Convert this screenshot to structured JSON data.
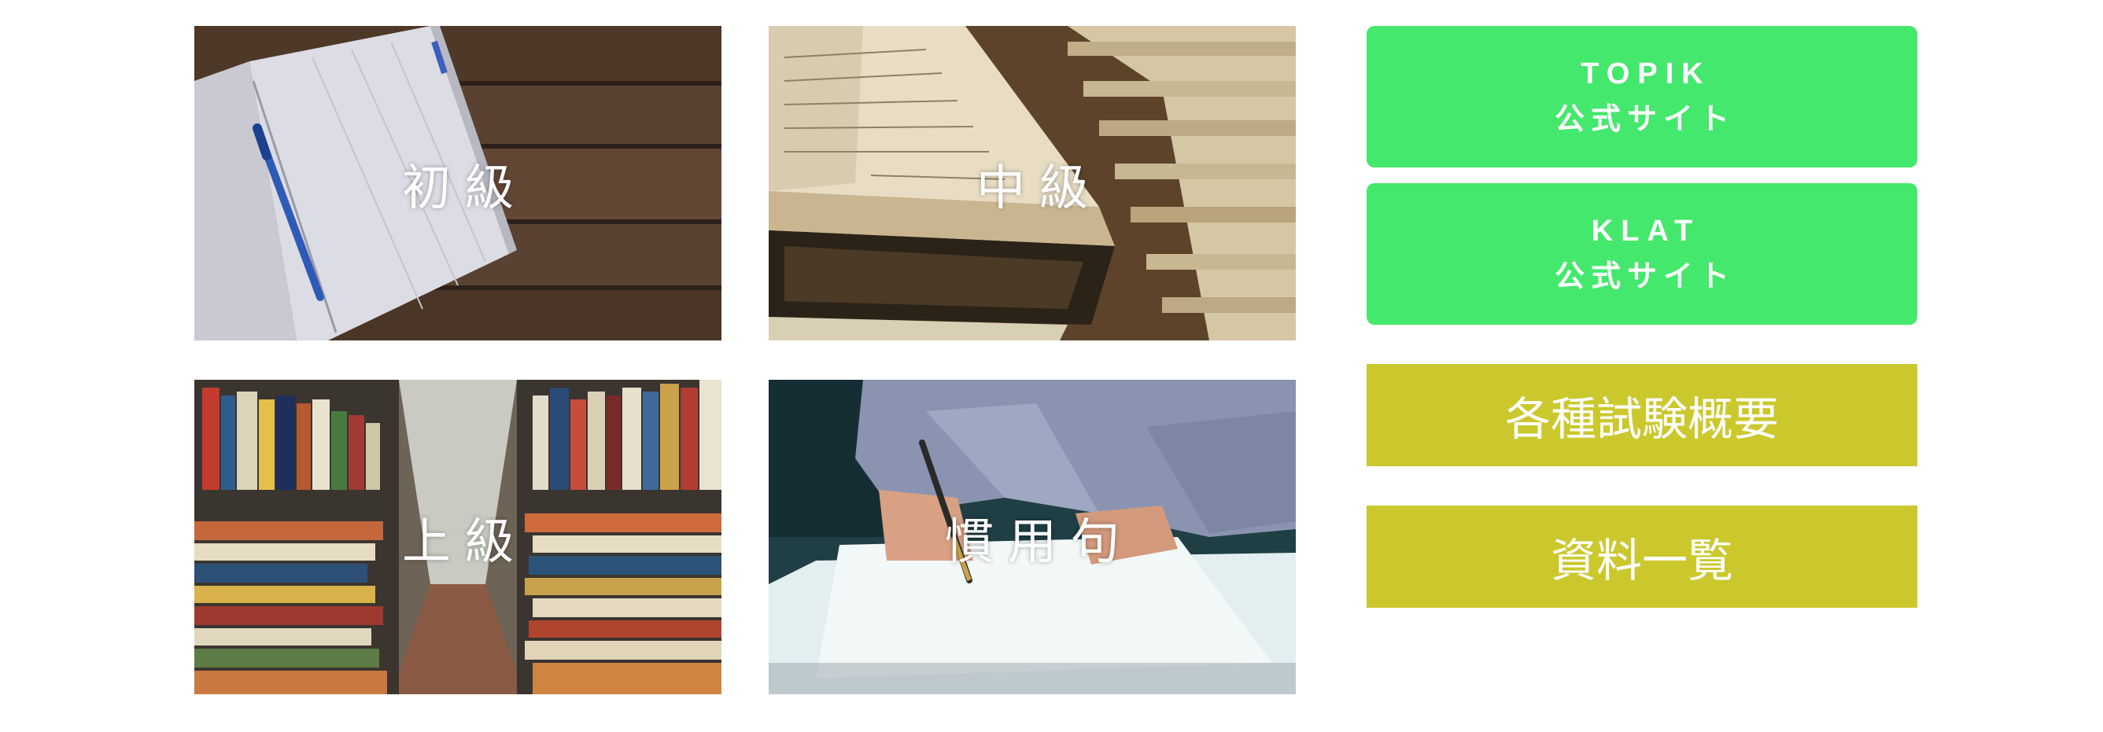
{
  "tiles": [
    {
      "label": "初級"
    },
    {
      "label": "中級"
    },
    {
      "label": "上級"
    },
    {
      "label": "慣用句"
    }
  ],
  "links": {
    "topik": {
      "line1": "TOPIK",
      "line2": "公式サイト"
    },
    "klat": {
      "line1": "KLAT",
      "line2": "公式サイト"
    },
    "exams": "各種試験概要",
    "docs": "資料一覧"
  },
  "colors": {
    "green_button": "#44e86c",
    "olive_button": "#cbc82e",
    "label_text": "#ffffff"
  }
}
